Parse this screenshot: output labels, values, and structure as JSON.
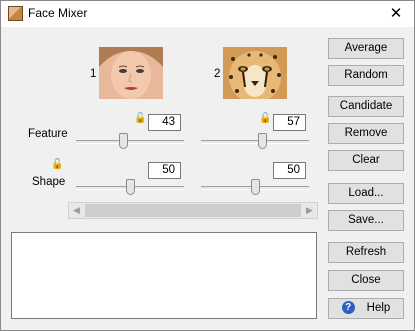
{
  "window": {
    "title": "Face Mixer",
    "close_glyph": "✕",
    "icon": "face-mixer-app-icon"
  },
  "faces": [
    {
      "label": "1",
      "image": "woman-face-portrait"
    },
    {
      "label": "2",
      "image": "cheetah-face-portrait"
    }
  ],
  "controls": {
    "feature": {
      "label": "Feature",
      "face1_value": "43",
      "face2_value": "57",
      "face1_slider": 0.43,
      "face2_slider": 0.57
    },
    "shape": {
      "label": "Shape",
      "face1_value": "50",
      "face2_value": "50",
      "face1_slider": 0.5,
      "face2_slider": 0.5
    }
  },
  "buttons": {
    "average": "Average",
    "random": "Random",
    "candidate": "Candidate",
    "remove": "Remove",
    "clear": "Clear",
    "load": "Load...",
    "save": "Save...",
    "refresh": "Refresh",
    "close": "Close",
    "help": "Help"
  },
  "icons": {
    "lock": "lock-icon",
    "help": "help-icon",
    "scroll_left": "◀",
    "scroll_right": "▶"
  },
  "help_glyph": "?",
  "lock_glyph": "🔓"
}
